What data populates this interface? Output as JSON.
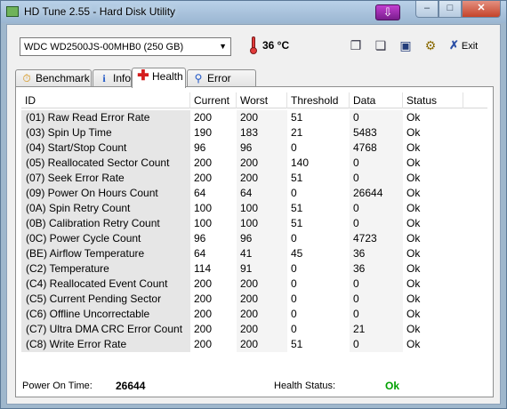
{
  "window": {
    "title": "HD Tune 2.55 - Hard Disk Utility"
  },
  "toolbar": {
    "drive": "WDC WD2500JS-00MHB0 (250 GB)",
    "temperature": "36 °C",
    "exit_label": "Exit"
  },
  "tabs": [
    {
      "label": "Benchmark",
      "icon": "stopwatch-icon"
    },
    {
      "label": "Info",
      "icon": "info-icon"
    },
    {
      "label": "Health",
      "icon": "health-cross-icon",
      "active": true
    },
    {
      "label": "Error Scan",
      "icon": "magnifier-icon"
    }
  ],
  "table": {
    "columns": [
      "ID",
      "Current",
      "Worst",
      "Threshold",
      "Data",
      "Status"
    ],
    "rows": [
      {
        "id": "(01) Raw Read Error Rate",
        "current": "200",
        "worst": "200",
        "threshold": "51",
        "data": "0",
        "status": "Ok"
      },
      {
        "id": "(03) Spin Up Time",
        "current": "190",
        "worst": "183",
        "threshold": "21",
        "data": "5483",
        "status": "Ok"
      },
      {
        "id": "(04) Start/Stop Count",
        "current": "96",
        "worst": "96",
        "threshold": "0",
        "data": "4768",
        "status": "Ok"
      },
      {
        "id": "(05) Reallocated Sector Count",
        "current": "200",
        "worst": "200",
        "threshold": "140",
        "data": "0",
        "status": "Ok"
      },
      {
        "id": "(07) Seek Error Rate",
        "current": "200",
        "worst": "200",
        "threshold": "51",
        "data": "0",
        "status": "Ok"
      },
      {
        "id": "(09) Power On Hours Count",
        "current": "64",
        "worst": "64",
        "threshold": "0",
        "data": "26644",
        "status": "Ok"
      },
      {
        "id": "(0A) Spin Retry Count",
        "current": "100",
        "worst": "100",
        "threshold": "51",
        "data": "0",
        "status": "Ok"
      },
      {
        "id": "(0B) Calibration Retry Count",
        "current": "100",
        "worst": "100",
        "threshold": "51",
        "data": "0",
        "status": "Ok"
      },
      {
        "id": "(0C) Power Cycle Count",
        "current": "96",
        "worst": "96",
        "threshold": "0",
        "data": "4723",
        "status": "Ok"
      },
      {
        "id": "(BE) Airflow Temperature",
        "current": "64",
        "worst": "41",
        "threshold": "45",
        "data": "36",
        "status": "Ok"
      },
      {
        "id": "(C2) Temperature",
        "current": "114",
        "worst": "91",
        "threshold": "0",
        "data": "36",
        "status": "Ok"
      },
      {
        "id": "(C4) Reallocated Event Count",
        "current": "200",
        "worst": "200",
        "threshold": "0",
        "data": "0",
        "status": "Ok"
      },
      {
        "id": "(C5) Current Pending Sector",
        "current": "200",
        "worst": "200",
        "threshold": "0",
        "data": "0",
        "status": "Ok"
      },
      {
        "id": "(C6) Offline Uncorrectable",
        "current": "200",
        "worst": "200",
        "threshold": "0",
        "data": "0",
        "status": "Ok"
      },
      {
        "id": "(C7) Ultra DMA CRC Error Count",
        "current": "200",
        "worst": "200",
        "threshold": "0",
        "data": "21",
        "status": "Ok"
      },
      {
        "id": "(C8) Write Error Rate",
        "current": "200",
        "worst": "200",
        "threshold": "51",
        "data": "0",
        "status": "Ok"
      }
    ]
  },
  "status_bar": {
    "power_on_label": "Power On Time:",
    "power_on_value": "26644",
    "health_label": "Health Status:",
    "health_value": "Ok"
  },
  "colors": {
    "health_ok": "#00a000"
  }
}
